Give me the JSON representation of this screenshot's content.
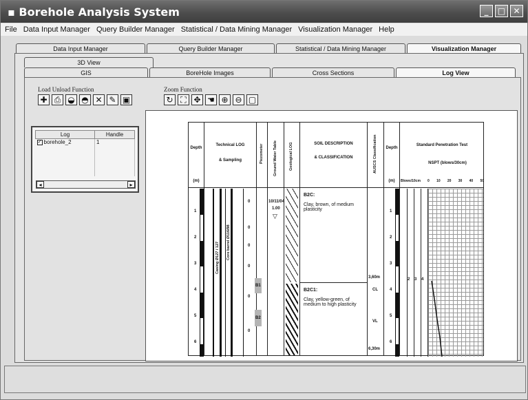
{
  "window": {
    "title": "Borehole Analysis System",
    "buttons": [
      "_",
      "□",
      "✕"
    ]
  },
  "menu": [
    "File",
    "Data Input Manager",
    "Query Builder Manager",
    "Statistical / Data Mining Manager",
    "Visualization Manager",
    "Help"
  ],
  "main_tabs": [
    "Data Input Manager",
    "Query Builder Manager",
    "Statistical / Data Mining Manager",
    "Visualization Manager"
  ],
  "main_tabs_active": "Visualization Manager",
  "view_tabs_row1": [
    "3D View"
  ],
  "view_tabs_row2": [
    "GIS",
    "BoreHole Images",
    "Cross Sections",
    "Log View"
  ],
  "view_tabs_active": "Log View",
  "toolbars": {
    "load_unload": {
      "label": "Load Unload Function",
      "buttons": [
        "add-icon",
        "print-icon",
        "open-icon",
        "load-icon",
        "delete-icon",
        "edit-icon",
        "window-icon"
      ]
    },
    "zoom": {
      "label": "Zoom Function",
      "buttons": [
        "refresh-icon",
        "fit-icon",
        "extent-icon",
        "pan-icon",
        "zoom-in-icon",
        "zoom-out-icon",
        "zoom-box-icon"
      ]
    }
  },
  "log_list": {
    "columns": [
      "Log",
      "Handle"
    ],
    "rows": [
      {
        "log": "borehole_2",
        "handle": "1",
        "checked": true
      }
    ]
  },
  "log_sheet": {
    "headers": {
      "depth": "Depth",
      "depth_unit": "(m)",
      "technical_log": "Technical LOG",
      "sampling": "& Sampling",
      "piezometer": "Piezometer",
      "ground_water": "Ground Water Table",
      "geological_log": "Geological LOG",
      "soil_description": "SOIL DESCRIPTION",
      "classification": "& CLASSIFICATION",
      "uscs": "AUSCS Classification",
      "depth2": "Depth",
      "depth2_unit": "(m)",
      "spt": "Standard Penetration Test",
      "nspt": "NSPT",
      "blows_unit": "(blows/30cm)",
      "blows_label": "Blows/10cm",
      "spt_scale": [
        "0",
        "10",
        "20",
        "30",
        "40",
        "50"
      ]
    },
    "depth_ticks": [
      "1",
      "2",
      "3",
      "4",
      "5",
      "6"
    ],
    "water_table": {
      "date": "10/11/04",
      "level": "1.00"
    },
    "casing_label": "Casing Ø127 / 127",
    "core_label": "Core barrel Ø116/98",
    "layers": [
      {
        "code": "B2C:",
        "text": "Clay, brown, of medium plasticity"
      },
      {
        "code": "B2C1:",
        "text": "Clay, yellow-green, of medium to high plasticity"
      }
    ],
    "uscs_values": [
      "CL",
      "VL"
    ],
    "layer_depths": [
      "3,60m",
      "6,30m"
    ],
    "sample_marks": [
      "0",
      "0",
      "0",
      "0",
      "0",
      "0"
    ],
    "sample_ids": [
      "B1",
      "B2"
    ],
    "spt_values": [
      "2",
      "3",
      "4"
    ]
  }
}
